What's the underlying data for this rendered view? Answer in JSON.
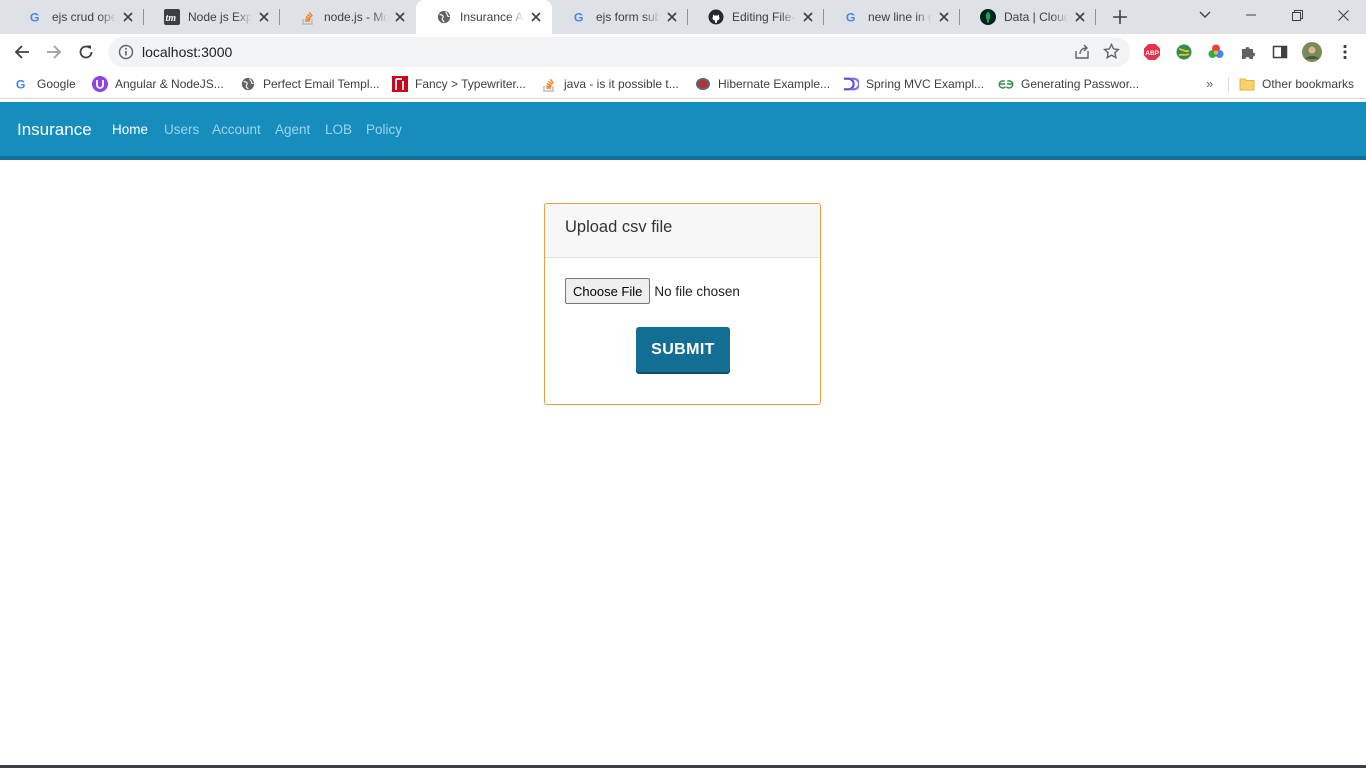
{
  "browser": {
    "tabs": [
      {
        "title": "ejs crud operation",
        "icon": "google-icon"
      },
      {
        "title": "Node js Express",
        "icon": "tm-icon"
      },
      {
        "title": "node.js - Mongoose",
        "icon": "stackoverflow-icon"
      },
      {
        "title": "Insurance App",
        "icon": "globe-icon",
        "active": true
      },
      {
        "title": "ejs form submit",
        "icon": "google-icon"
      },
      {
        "title": "Editing File-Upload",
        "icon": "github-icon"
      },
      {
        "title": "new line in git",
        "icon": "google-icon"
      },
      {
        "title": "Data | Cloud",
        "icon": "mongodb-icon"
      }
    ],
    "url": "localhost:3000",
    "bookmarks": [
      {
        "label": "Google",
        "icon": "google-icon"
      },
      {
        "label": "Angular & NodeJS...",
        "icon": "angular-node-icon"
      },
      {
        "label": "Perfect Email Templ...",
        "icon": "globe-icon"
      },
      {
        "label": "Fancy > Typewriter...",
        "icon": "fancy-icon"
      },
      {
        "label": "java - is it possible t...",
        "icon": "stackoverflow-icon"
      },
      {
        "label": "Hibernate Example...",
        "icon": "hibernate-icon"
      },
      {
        "label": "Spring MVC Exampl...",
        "icon": "dd-icon"
      },
      {
        "label": "Generating Passwor...",
        "icon": "gfg-icon"
      }
    ],
    "bookmarks_more": "»",
    "other_bookmarks": "Other bookmarks",
    "colors": {
      "tabstrip": "#dee1e6",
      "omnibox": "#f1f3f4"
    }
  },
  "app": {
    "brand": "Insurance",
    "nav": [
      "Home",
      "Users",
      "Account",
      "Agent",
      "LOB",
      "Policy"
    ],
    "active_nav": "Home",
    "colors": {
      "navbar": "#168dbd",
      "submit": "#126e93",
      "card_border": "#e8a04a"
    }
  },
  "upload": {
    "title": "Upload csv file",
    "choose_label": "Choose File",
    "file_status": "No file chosen",
    "submit_label": "SUBMIT"
  }
}
